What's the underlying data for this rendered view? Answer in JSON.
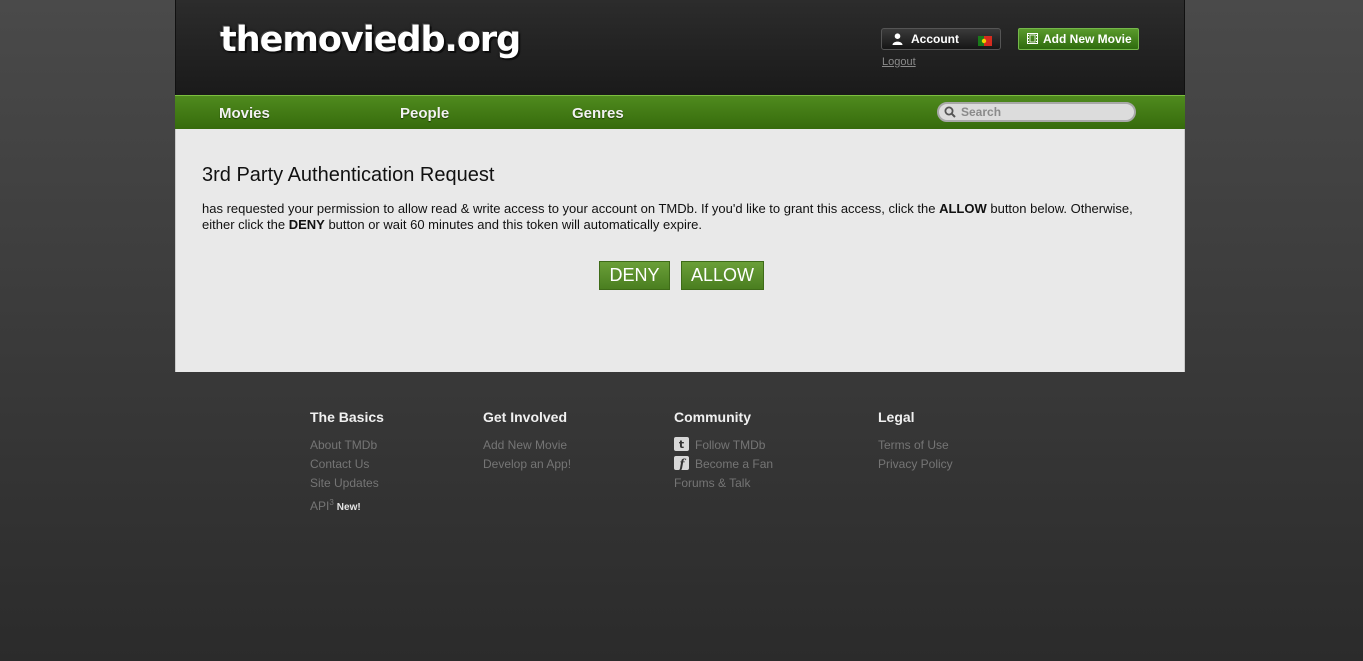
{
  "header": {
    "logo_text": "themoviedb.org",
    "account_label": "Account",
    "logout_label": "Logout",
    "add_movie_label": "Add New Movie"
  },
  "nav": {
    "items": [
      {
        "label": "Movies"
      },
      {
        "label": "People"
      },
      {
        "label": "Genres"
      }
    ],
    "search_placeholder": "Search"
  },
  "main": {
    "title": "3rd Party Authentication Request",
    "message_part1": "has requested your permission to allow read & write access to your account on TMDb. If you'd like to grant this access, click the ",
    "message_allow": "ALLOW",
    "message_part2": " button below. Otherwise, either click the ",
    "message_deny": "DENY",
    "message_part3": " button or wait 60 minutes and this token will automatically expire.",
    "deny_label": "DENY",
    "allow_label": "ALLOW"
  },
  "footer": {
    "basics": {
      "title": "The Basics",
      "links": [
        "About TMDb",
        "Contact Us",
        "Site Updates"
      ],
      "api_label": "API",
      "api_sup": "3",
      "api_badge": "New!"
    },
    "involved": {
      "title": "Get Involved",
      "links": [
        "Add New Movie",
        "Develop an App!"
      ]
    },
    "community": {
      "title": "Community",
      "links": [
        "Follow TMDb",
        "Become a Fan",
        "Forums & Talk"
      ]
    },
    "legal": {
      "title": "Legal",
      "links": [
        "Terms of Use",
        "Privacy Policy"
      ]
    }
  },
  "colors": {
    "brand_green": "#4f8a1e",
    "button_green": "#5b8f2c",
    "content_bg": "#e9e9e9"
  },
  "icons": {
    "account": "user-icon",
    "flag": "portugal-flag-icon",
    "add_movie": "film-icon",
    "search": "search-icon",
    "twitter": "twitter-icon",
    "facebook": "facebook-icon"
  }
}
